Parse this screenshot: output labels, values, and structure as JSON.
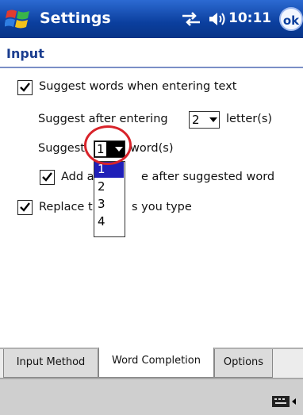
{
  "titlebar": {
    "title": "Settings",
    "time": "10:11",
    "ok_label": "ok"
  },
  "page": {
    "title": "Input"
  },
  "options": {
    "suggest_words_label": "Suggest words when entering text",
    "suggest_after_label": "Suggest after entering",
    "suggest_after_value": "2",
    "suggest_after_suffix": "letter(s)",
    "suggest_label": "Suggest",
    "suggest_value": "1",
    "suggest_suffix": "word(s)",
    "add_space_label_a": "Add a",
    "add_space_label_b": "e after suggested word",
    "replace_label_a": "Replace t",
    "replace_label_b": "s you type",
    "suggest_word_list": [
      "1",
      "2",
      "3",
      "4"
    ]
  },
  "tabs": [
    "Input Method",
    "Word Completion",
    "Options"
  ],
  "active_tab": "Word Completion",
  "colors": {
    "titlebar": "#0b3f9e",
    "highlight_circle": "#d8232a",
    "list_selection": "#1f1fb8"
  }
}
